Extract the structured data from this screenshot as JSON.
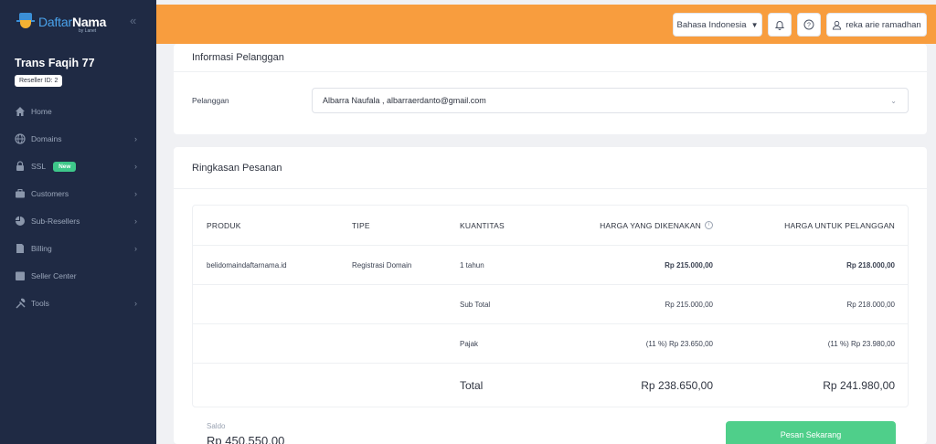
{
  "brand": {
    "name_part1": "Daftar",
    "name_part2": "Nama",
    "tagline": "by Lanet"
  },
  "account": {
    "name": "Trans Faqih 77",
    "reseller_id": "Reseller ID: 2"
  },
  "sidebar": {
    "items": [
      {
        "label": "Home",
        "icon": "home-icon",
        "chevron": false
      },
      {
        "label": "Domains",
        "icon": "globe-icon",
        "chevron": true
      },
      {
        "label": "SSL",
        "icon": "lock-icon",
        "chevron": true,
        "badge": "New"
      },
      {
        "label": "Customers",
        "icon": "briefcase-icon",
        "chevron": true
      },
      {
        "label": "Sub-Resellers",
        "icon": "pie-icon",
        "chevron": true
      },
      {
        "label": "Billing",
        "icon": "document-icon",
        "chevron": true
      },
      {
        "label": "Seller Center",
        "icon": "store-icon",
        "chevron": false
      },
      {
        "label": "Tools",
        "icon": "tools-icon",
        "chevron": true
      }
    ]
  },
  "topbar": {
    "language": "Bahasa Indonesia",
    "user": "reka arie ramadhan",
    "help_symbol": "?"
  },
  "customer_card": {
    "title": "Informasi Pelanggan",
    "label": "Pelanggan",
    "value": "Albarra Naufala , albarraerdanto@gmail.com"
  },
  "summary_card": {
    "title": "Ringkasan Pesanan",
    "columns": [
      "PRODUK",
      "TIPE",
      "KUANTITAS",
      "HARGA YANG DIKENAKAN",
      "HARGA UNTUK PELANGGAN"
    ],
    "info_symbol": "i",
    "item": {
      "product": "belidomaindaftarnama.id",
      "type": "Registrasi Domain",
      "quantity": "1 tahun",
      "charged": "Rp 215.000,00",
      "customer_price": "Rp 218.000,00"
    },
    "subtotal": {
      "label": "Sub Total",
      "charged": "Rp 215.000,00",
      "customer_price": "Rp 218.000,00"
    },
    "tax": {
      "label": "Pajak",
      "charged": "(11 %) Rp 23.650,00",
      "customer_price": "(11 %) Rp 23.980,00"
    },
    "total": {
      "label": "Total",
      "charged": "Rp 238.650,00",
      "customer_price": "Rp 241.980,00"
    },
    "saldo_label": "Saldo",
    "saldo_value": "Rp 450.550,00",
    "order_button": "Pesan Sekarang"
  },
  "colors": {
    "sidebar": "#1f2a44",
    "topbar": "#f89d3e",
    "accent_green": "#4fcf8a",
    "new_badge": "#3ec78a"
  }
}
